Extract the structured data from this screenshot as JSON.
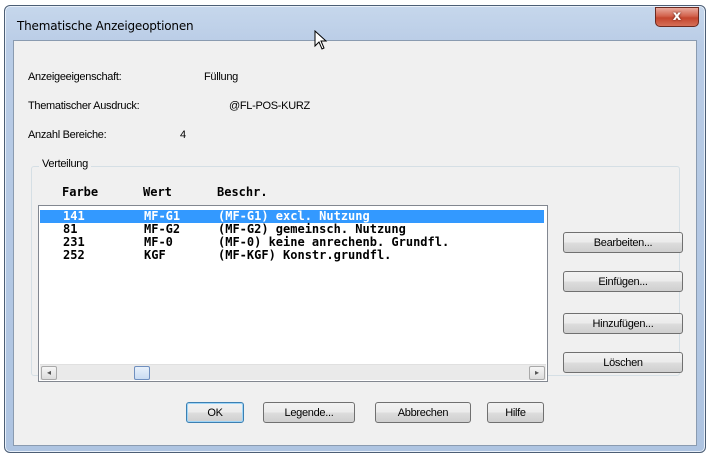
{
  "window": {
    "title": "Thematische Anzeigeoptionen",
    "close_glyph": "x"
  },
  "fields": {
    "anzeigeeigenschaft": {
      "label": "Anzeigeeigenschaft:",
      "value": "Füllung"
    },
    "ausdruck": {
      "label": "Thematischer Ausdruck:",
      "value": "@FL-POS-KURZ"
    },
    "bereiche": {
      "label": "Anzahl Bereiche:",
      "value": "4"
    }
  },
  "group": {
    "label": "Verteilung"
  },
  "table": {
    "headers": {
      "farbe": "Farbe",
      "wert": "Wert",
      "beschr": "Beschr."
    },
    "rows": [
      {
        "farbe": "141",
        "wert": "MF-G1",
        "beschr": "(MF-G1) excl. Nutzung",
        "selected": true
      },
      {
        "farbe": "81",
        "wert": "MF-G2",
        "beschr": "(MF-G2) gemeinsch. Nutzung",
        "selected": false
      },
      {
        "farbe": "231",
        "wert": "MF-0",
        "beschr": "(MF-0) keine anrechenb. Grundfl.",
        "selected": false
      },
      {
        "farbe": "252",
        "wert": "KGF",
        "beschr": "(MF-KGF) Konstr.grundfl.",
        "selected": false
      }
    ]
  },
  "side_buttons": {
    "bearbeiten": "Bearbeiten...",
    "einfuegen": "Einfügen...",
    "hinzufuegen": "Hinzufügen...",
    "loeschen": "Löschen"
  },
  "bottom_buttons": {
    "ok": "OK",
    "legende": "Legende...",
    "abbrechen": "Abbrechen",
    "hilfe": "Hilfe"
  },
  "scroll": {
    "left_arrow": "◂",
    "right_arrow": "▸"
  },
  "colors": {
    "selection": "#3399ff",
    "close": "#c4452e"
  }
}
